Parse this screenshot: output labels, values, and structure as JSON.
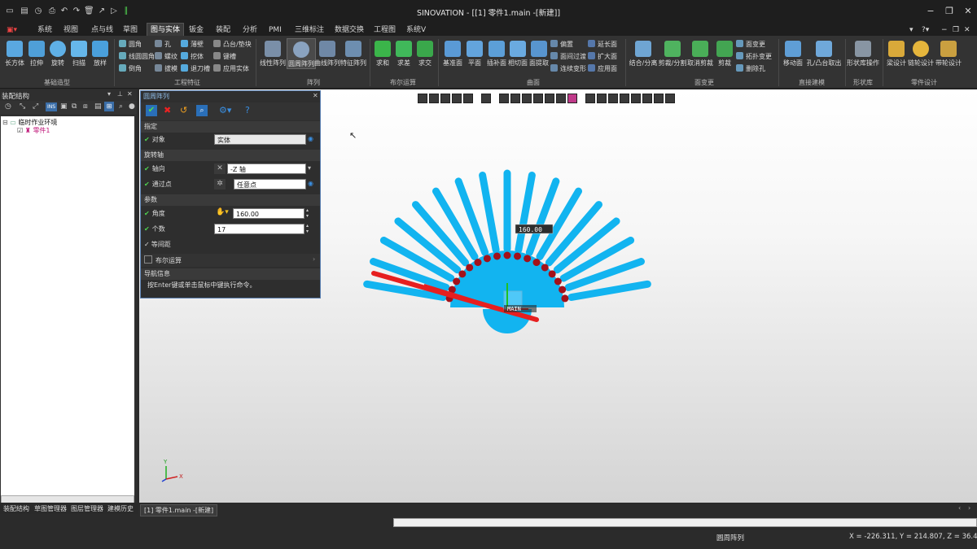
{
  "app": {
    "title": "SINOVATION - [[1] 零件1.main -[新建]]"
  },
  "menu": [
    {
      "label": "系统"
    },
    {
      "label": "视图"
    },
    {
      "label": "点与线"
    },
    {
      "label": "草图"
    },
    {
      "label": "图与实体",
      "active": true
    },
    {
      "label": "钣金"
    },
    {
      "label": "装配"
    },
    {
      "label": "分析"
    },
    {
      "label": "PMI"
    },
    {
      "label": "三维标注"
    },
    {
      "label": "数据交换"
    },
    {
      "label": "工程图"
    },
    {
      "label": "系统V"
    }
  ],
  "ribbon": {
    "basic": {
      "items": [
        "长方体",
        "拉伸",
        "旋转",
        "扫描",
        "放样"
      ],
      "group": "基础造型"
    },
    "feature": {
      "col1": [
        "圆角",
        "线圆圆角",
        "倒角"
      ],
      "col2": [
        "孔",
        "螺纹",
        "拔模"
      ],
      "col3": [
        "薄壁",
        "挖体",
        "退刀槽"
      ],
      "col4": [
        "凸台/垫块",
        "键槽",
        "应用实体"
      ],
      "group": "工程特征"
    },
    "array": {
      "items": [
        "线性阵列",
        "圆周阵列",
        "曲线阵列",
        "特征阵列"
      ],
      "group": "阵列"
    },
    "boolean": {
      "items": [
        "求和",
        "求差",
        "求交"
      ],
      "group": "布尔运算"
    },
    "surface": {
      "items": [
        "基准面",
        "平面",
        "插补面",
        "相切面",
        "面提取"
      ],
      "col1": [
        "偏置",
        "面间过渡",
        "连续变形"
      ],
      "col2": [
        "延长面",
        "扩大面",
        "应用面"
      ],
      "group": "曲面"
    },
    "faceedit": {
      "items": [
        "结合/分离",
        "剪裁/分割",
        "取消剪裁",
        "剪裁"
      ],
      "col1": [
        "面变更",
        "拓扑变更",
        "删除孔"
      ],
      "group": "面变更"
    },
    "direct": {
      "items": [
        "移动面",
        "孔/凸台取出"
      ],
      "group": "直接建模"
    },
    "shape": {
      "items": [
        "形状库操作"
      ],
      "group": "形状库"
    },
    "part": {
      "items": [
        "梁设计",
        "链轮设计",
        "带轮设计"
      ],
      "group": "零件设计"
    }
  },
  "left_panel": {
    "title": "装配结构",
    "tree": [
      {
        "label": "临时作业环境"
      },
      {
        "label": "零件1"
      }
    ],
    "tabs": [
      "装配结构",
      "草图管理器",
      "图层管理器",
      "建模历史"
    ]
  },
  "dialog": {
    "title": "圆周阵列",
    "sections": {
      "specify": "指定",
      "axis": "旋转轴",
      "params": "参数",
      "boolean": "布尔运算",
      "nav": "导航信息"
    },
    "object_label": "对象",
    "object_value": "实体",
    "direction_label": "轴向",
    "direction_value": "-Z 轴",
    "through_label": "通过点",
    "through_value": "任意点",
    "angle_label": "角度",
    "angle_value": "160.00",
    "count_label": "个数",
    "count_value": "17",
    "equal_label": "等间距",
    "nav_text": "按Enter键或单击鼠标中键执行命令。"
  },
  "viewport": {
    "angle_tag": "160.00",
    "fan_count": 17,
    "fan_angle_deg": 160,
    "colors": {
      "blade": "#12b4f0",
      "source": "#e61f1f",
      "knob": "#a3111a"
    },
    "axis_x": "X",
    "axis_y": "Y"
  },
  "doc_tab": "[1] 零件1.main -[新建]",
  "status": {
    "command": "圆周阵列",
    "coords": "X = -226.311, Y = 214.807, Z = 36.409"
  }
}
